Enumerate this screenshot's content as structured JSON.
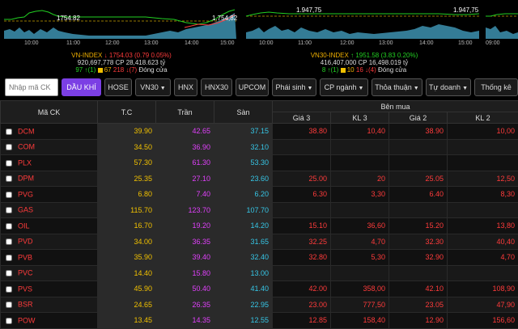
{
  "charts": {
    "vn": {
      "ref_label": "1754.82",
      "ref_label_right": "1.754,82",
      "times": [
        "10:00",
        "11:00",
        "12:00",
        "13:00",
        "14:00",
        "15:00"
      ]
    },
    "vn30": {
      "ref_label": "1.947,75",
      "ref_label_right": "1.947,75",
      "times": [
        "10:00",
        "11:00",
        "12:00",
        "13:00",
        "14:00",
        "15:00"
      ]
    },
    "third": {
      "times": [
        "09:00"
      ]
    }
  },
  "indices": {
    "vn": {
      "name": "VN-INDEX",
      "arrow": "↓",
      "value": "1754.03",
      "change": "(0.79  0.05%)",
      "volume": "920,697,778",
      "cp_label": "CP",
      "cp_value": "28,418.623 tỷ",
      "up": "97 ↑(1)",
      "ref": "67",
      "down": "218 ↓(7)",
      "status": "Đóng cửa"
    },
    "vn30": {
      "name": "VN30-INDEX",
      "arrow": "↑",
      "value": "1951.58",
      "change": "(3.83  0.20%)",
      "volume": "416,407,000",
      "cp_label": "CP",
      "cp_value": "16,498.019 tỷ",
      "up": "8 ↑(1)",
      "ref": "10",
      "down": "16 ↓(4)",
      "status": "Đóng cửa"
    }
  },
  "toolbar": {
    "search_placeholder": "Nhập mã CK",
    "items": [
      "DẦU KHÍ",
      "HOSE",
      "VN30",
      "HNX",
      "HNX30",
      "UPCOM",
      "Phái sinh",
      "CP ngành",
      "Thỏa thuận",
      "Tự doanh",
      "Thống kê"
    ]
  },
  "table": {
    "headers": {
      "symbol": "Mã CK",
      "ref": "T.C",
      "ceil": "Trần",
      "floor": "Sàn",
      "bid_group": "Bên mua",
      "g3": "Giá 3",
      "kl3": "KL 3",
      "g2": "Giá 2",
      "kl2": "KL 2"
    },
    "rows": [
      {
        "sym": "DCM",
        "tc": "39.90",
        "tran": "42.65",
        "san": "37.15",
        "g3": "38.80",
        "kl3": "10,40",
        "g2": "38.90",
        "kl2": "10,00"
      },
      {
        "sym": "COM",
        "tc": "34.50",
        "tran": "36.90",
        "san": "32.10",
        "g3": "",
        "kl3": "",
        "g2": "",
        "kl2": ""
      },
      {
        "sym": "PLX",
        "tc": "57.30",
        "tran": "61.30",
        "san": "53.30",
        "g3": "",
        "kl3": "",
        "g2": "",
        "kl2": ""
      },
      {
        "sym": "DPM",
        "tc": "25.35",
        "tran": "27.10",
        "san": "23.60",
        "g3": "25.00",
        "kl3": "20",
        "g2": "25.05",
        "kl2": "12,50"
      },
      {
        "sym": "PVG",
        "tc": "6.80",
        "tran": "7.40",
        "san": "6.20",
        "g3": "6.30",
        "kl3": "3,30",
        "g2": "6.40",
        "kl2": "8,30"
      },
      {
        "sym": "GAS",
        "tc": "115.70",
        "tran": "123.70",
        "san": "107.70",
        "g3": "",
        "kl3": "",
        "g2": "",
        "kl2": ""
      },
      {
        "sym": "OIL",
        "tc": "16.70",
        "tran": "19.20",
        "san": "14.20",
        "g3": "15.10",
        "kl3": "36,60",
        "g2": "15.20",
        "kl2": "13,80"
      },
      {
        "sym": "PVD",
        "tc": "34.00",
        "tran": "36.35",
        "san": "31.65",
        "g3": "32.25",
        "kl3": "4,70",
        "g2": "32.30",
        "kl2": "40,40"
      },
      {
        "sym": "PVB",
        "tc": "35.90",
        "tran": "39.40",
        "san": "32.40",
        "g3": "32.80",
        "kl3": "5,30",
        "g2": "32.90",
        "kl2": "4,70"
      },
      {
        "sym": "PVC",
        "tc": "14.40",
        "tran": "15.80",
        "san": "13.00",
        "g3": "",
        "kl3": "",
        "g2": "",
        "kl2": ""
      },
      {
        "sym": "PVS",
        "tc": "45.90",
        "tran": "50.40",
        "san": "41.40",
        "g3": "42.00",
        "kl3": "358,00",
        "g2": "42.10",
        "kl2": "108,90"
      },
      {
        "sym": "BSR",
        "tc": "24.65",
        "tran": "26.35",
        "san": "22.95",
        "g3": "23.00",
        "kl3": "777,50",
        "g2": "23.05",
        "kl2": "47,90"
      },
      {
        "sym": "POW",
        "tc": "13.45",
        "tran": "14.35",
        "san": "12.55",
        "g3": "12.85",
        "kl3": "158,40",
        "g2": "12.90",
        "kl2": "156,60"
      }
    ]
  },
  "colors": {
    "ref": "#f0c000",
    "ceil": "#e040fb",
    "floor": "#36c6e6",
    "down": "#ff3b3b",
    "up": "#22d022",
    "accent": "#7b3fe4"
  }
}
